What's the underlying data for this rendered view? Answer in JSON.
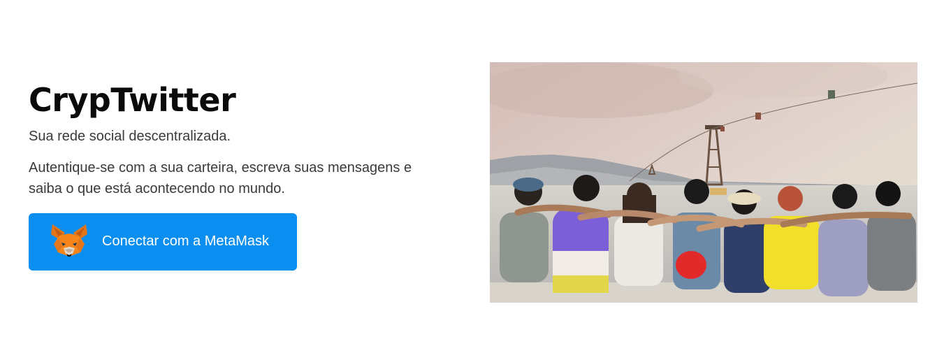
{
  "hero": {
    "title": "CrypTwitter",
    "tagline": "Sua rede social descentralizada.",
    "description": "Autentique-se com a sua carteira, escreva suas mensagens e saiba o que está acontecendo no mundo.",
    "connect_button": {
      "label": "Conectar com a MetaMask",
      "icon": "metamask-fox-icon",
      "color": "#0a8ff0"
    }
  },
  "photo": {
    "subject": "group-of-friends-by-the-sea",
    "colors": {
      "sky_top": "#d9c3bd",
      "sky_bottom": "#e4dfd0",
      "sea": "#c9c7c3"
    }
  }
}
